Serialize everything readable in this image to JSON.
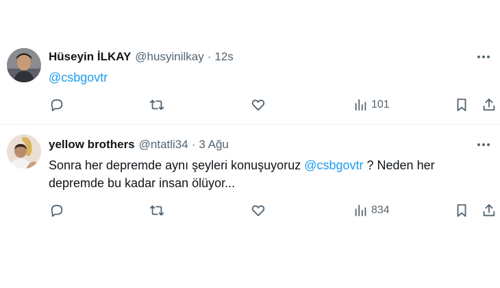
{
  "tweets": [
    {
      "name": "Hüseyin İLKAY",
      "handle": "@husyinilkay",
      "separator": "·",
      "time": "12s",
      "text_parts": [
        {
          "mention": "@csbgovtr"
        }
      ],
      "views": "101",
      "avatar_icon": "profile-photo"
    },
    {
      "name": "yellow brothers",
      "handle": "@ntatli34",
      "separator": "·",
      "time": "3 Ağu",
      "text_before": "Sonra her depremde aynı şeyleri konuşuyoruz ",
      "mention": "@csbgovtr",
      "text_after": " ? Neden her depremde bu kadar insan ölüyor...",
      "views": "834",
      "avatar_icon": "profile-photo"
    }
  ],
  "icons": {
    "reply": "reply-icon",
    "retweet": "retweet-icon",
    "like": "like-icon",
    "views": "views-icon",
    "bookmark": "bookmark-icon",
    "share": "share-icon",
    "more": "more-icon"
  },
  "colors": {
    "mention": "#1d9bf0",
    "secondary": "#536471",
    "text": "#0f1419"
  }
}
